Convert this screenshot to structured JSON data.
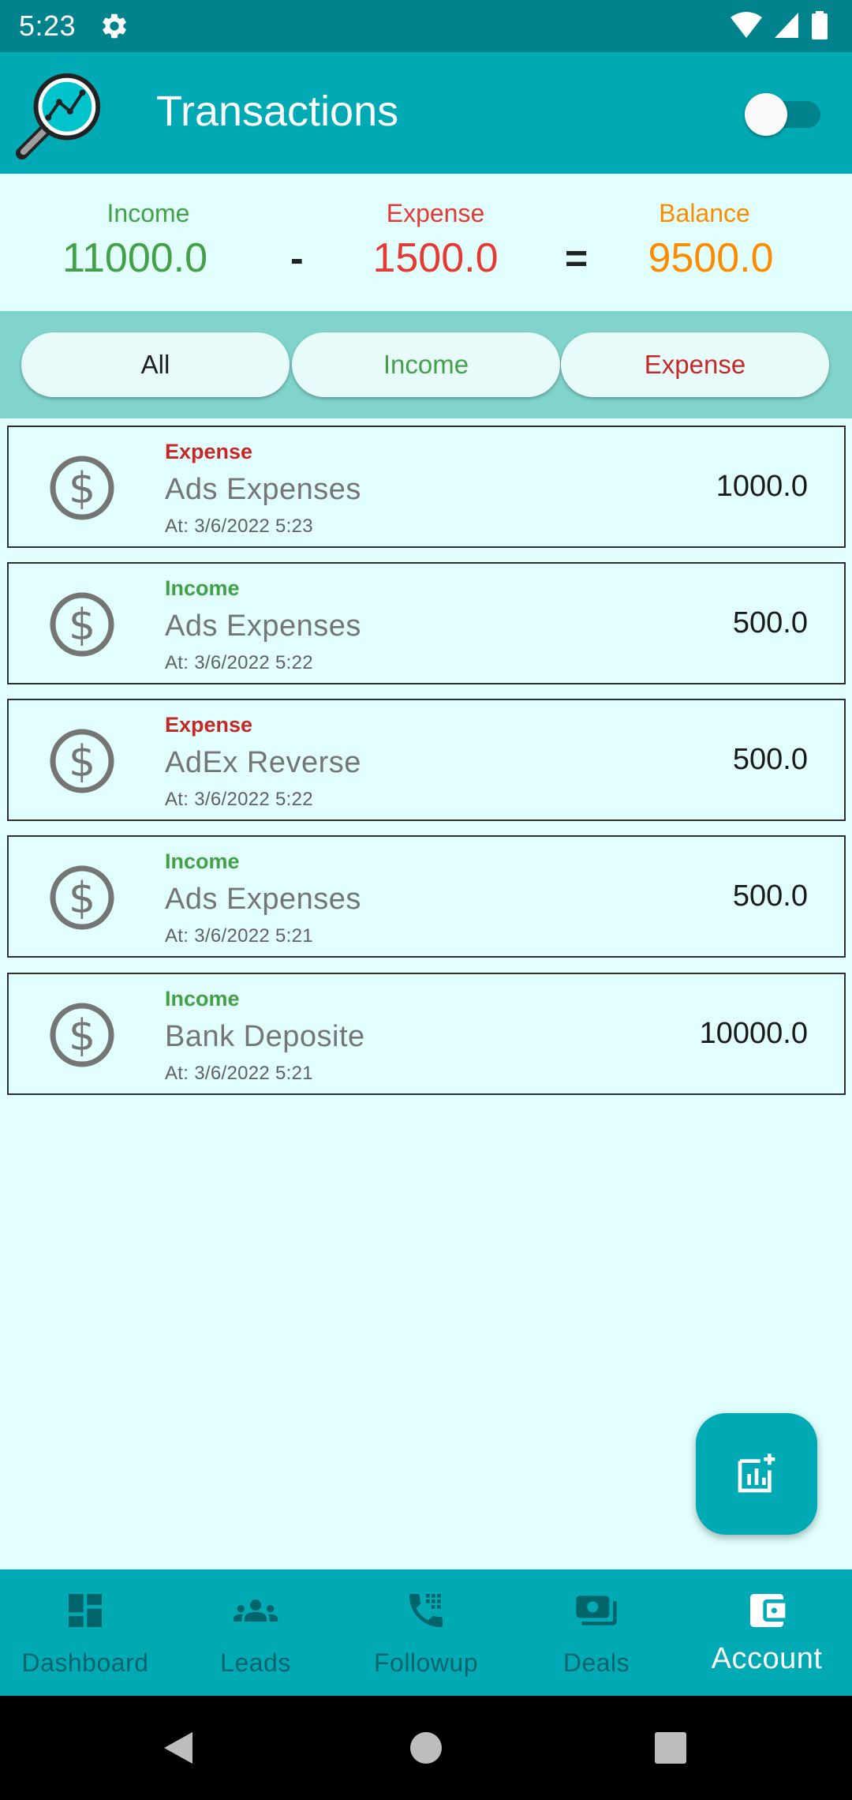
{
  "status_bar": {
    "time": "5:23"
  },
  "app_bar": {
    "title": "Transactions",
    "toggle_on": false
  },
  "summary": {
    "income_label": "Income",
    "income_value": "11000.0",
    "minus": "-",
    "expense_label": "Expense",
    "expense_value": "1500.0",
    "equals": "=",
    "balance_label": "Balance",
    "balance_value": "9500.0"
  },
  "filters": {
    "all": "All",
    "income": "Income",
    "expense": "Expense",
    "selected": "All"
  },
  "transactions": [
    {
      "type": "Expense",
      "title": "Ads Expenses",
      "date": "At: 3/6/2022 5:23",
      "amount": "1000.0"
    },
    {
      "type": "Income",
      "title": "Ads Expenses",
      "date": "At: 3/6/2022 5:22",
      "amount": "500.0"
    },
    {
      "type": "Expense",
      "title": "AdEx Reverse",
      "date": "At: 3/6/2022 5:22",
      "amount": "500.0"
    },
    {
      "type": "Income",
      "title": "Ads Expenses",
      "date": "At: 3/6/2022 5:21",
      "amount": "500.0"
    },
    {
      "type": "Income",
      "title": "Bank Deposite",
      "date": "At: 3/6/2022 5:21",
      "amount": "10000.0"
    }
  ],
  "nav": {
    "dashboard": "Dashboard",
    "leads": "Leads",
    "followup": "Followup",
    "deals": "Deals",
    "account": "Account",
    "active": "Account"
  },
  "colors": {
    "primary": "#00aab4",
    "primary_dark": "#00838c",
    "background": "#e0fffd",
    "income": "#43a047",
    "expense": "#c62828",
    "expense_summary": "#e53935",
    "balance": "#fb8c00"
  }
}
